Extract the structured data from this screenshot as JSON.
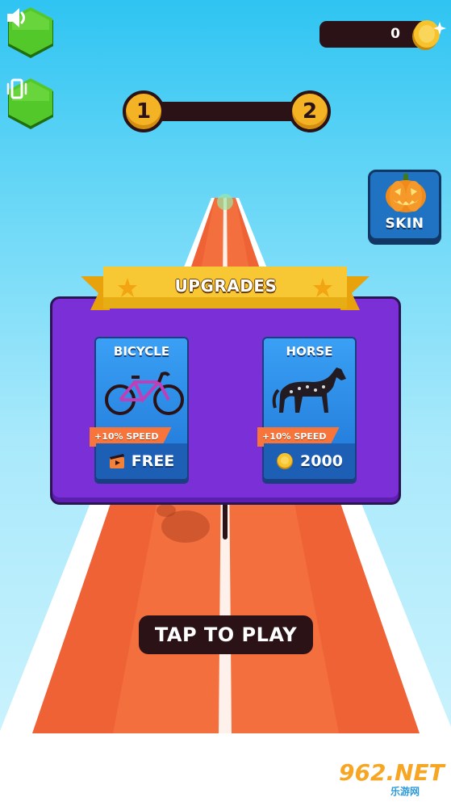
{
  "hud": {
    "coins": "0",
    "level_current": "1",
    "level_next": "2"
  },
  "buttons": {
    "sound_icon": "speaker-icon",
    "vibration_icon": "vibration-icon",
    "skin_label": "SKIN",
    "skin_icon": "pumpkin-icon",
    "tap_to_play": "TAP TO PLAY"
  },
  "upgrades": {
    "title": "UPGRADES",
    "items": [
      {
        "name": "BICYCLE",
        "tag": "+10% SPEED",
        "price": "FREE",
        "price_icon": "video-ad-icon"
      },
      {
        "name": "HORSE",
        "tag": "+10% SPEED",
        "price": "2000",
        "price_icon": "coin-icon"
      }
    ]
  },
  "watermark": {
    "brand": "962.NET",
    "sub": "乐游网"
  },
  "colors": {
    "sky": "#2fc4f2",
    "track": "#f0643a",
    "panel": "#7b2fd7",
    "card": "#1f76d6",
    "gold": "#f4b324",
    "button_green": "#4cc42a",
    "dark": "#2a1216"
  }
}
